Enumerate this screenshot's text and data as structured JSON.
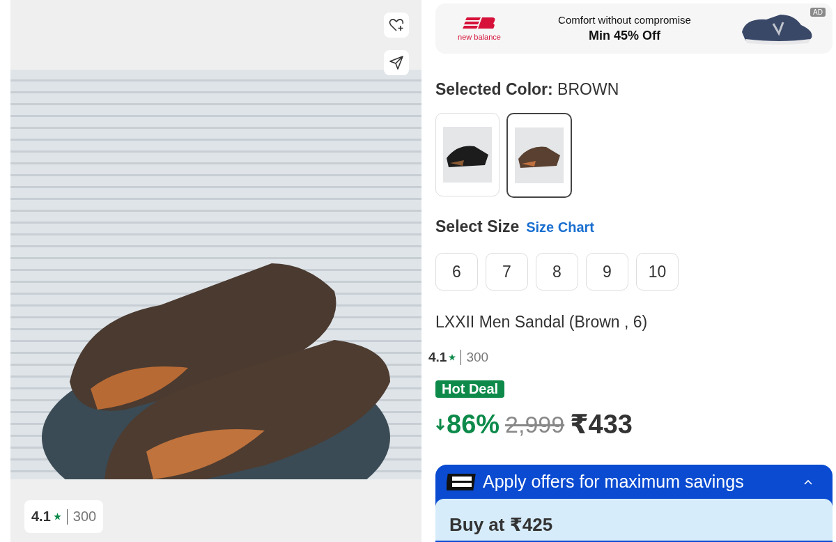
{
  "gallery": {
    "photo_rating": {
      "value": "4.1",
      "count": "300"
    }
  },
  "ad_banner": {
    "brand": "new balance",
    "headline": "Comfort without compromise",
    "offer": "Min 45% Off",
    "badge": "AD"
  },
  "color_picker": {
    "label": "Selected Color:",
    "value": "BROWN",
    "options": [
      {
        "kind": "black",
        "selected": false
      },
      {
        "kind": "brown",
        "selected": true
      }
    ]
  },
  "size_picker": {
    "label": "Select Size",
    "chart_link": "Size Chart",
    "sizes": [
      {
        "label": "6",
        "selected": false
      },
      {
        "label": "7",
        "selected": false
      },
      {
        "label": "8",
        "selected": false
      },
      {
        "label": "9",
        "selected": false
      },
      {
        "label": "10",
        "selected": false
      }
    ]
  },
  "product": {
    "title": "LXXII Men Sandal (Brown , 6)",
    "rating": "4.1",
    "rating_count": "300",
    "deal_badge": "Hot Deal",
    "discount": "86%",
    "mrp": "2,999",
    "price": "₹433"
  },
  "offers": {
    "title": "Apply offers for maximum savings",
    "expanded": true,
    "card_title": "Buy at ₹425"
  }
}
